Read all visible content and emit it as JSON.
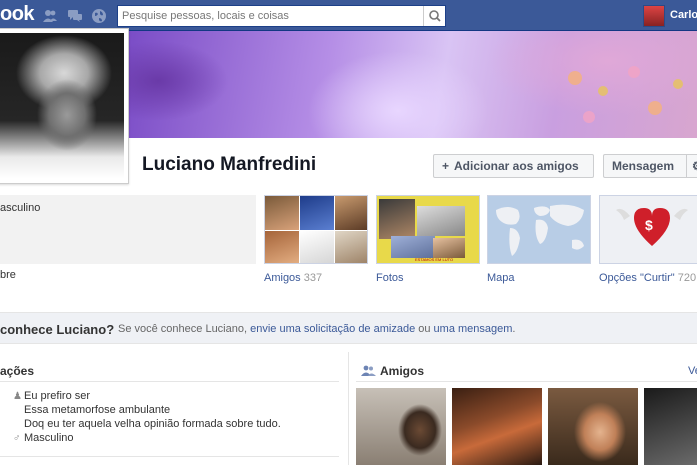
{
  "topbar": {
    "logo": "ook",
    "search_placeholder": "Pesquise pessoas, locais e coisas",
    "user_name": "Carlo"
  },
  "profile": {
    "name": "Luciano Manfredini",
    "add_friend_label": "Adicionar aos amigos",
    "message_label": "Mensagem",
    "gender_short": "asculino",
    "more_link": "bre"
  },
  "tiles": [
    {
      "label": "Amigos",
      "count": "337"
    },
    {
      "label": "Fotos",
      "count": ""
    },
    {
      "label": "Mapa",
      "count": ""
    },
    {
      "label": "Opções \"Curtir\"",
      "count": "720"
    }
  ],
  "photos_tile": {
    "caption": "ESTAMOS EM LUTO"
  },
  "banner": {
    "question": "conhece Luciano?",
    "pre": "Se você conhece Luciano, ",
    "link1": "envie uma solicitação de amizade",
    "mid": " ou ",
    "link2": "uma mensagem",
    "post": "."
  },
  "info": {
    "title": "ações",
    "quote_lines": [
      "Eu prefiro ser",
      "Essa metamorfose ambulante",
      "Doq eu ter aquela velha opinião formada sobre tudo."
    ],
    "gender": "Masculino"
  },
  "friends_section": {
    "title": "Amigos",
    "more": "Ve"
  },
  "colors": {
    "brand": "#3b5998",
    "link": "#3b5998",
    "banner_bg": "#eff1f5"
  }
}
